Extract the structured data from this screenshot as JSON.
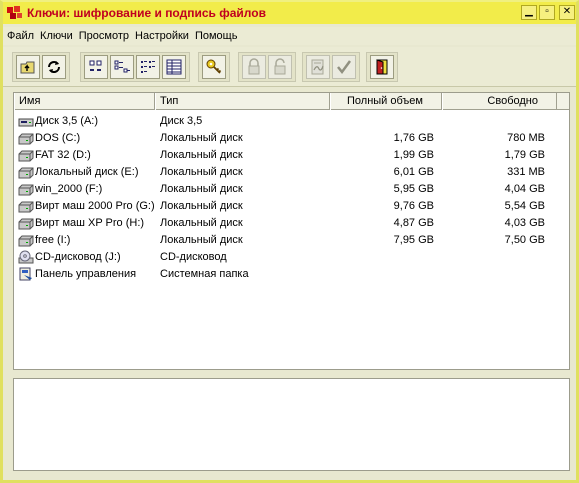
{
  "window": {
    "title": "Ключи: шифрование и подпись файлов",
    "accent_color": "#f2ec4a",
    "title_color": "#c00020",
    "controls": [
      "minimize-icon",
      "maximize-icon",
      "close-icon"
    ]
  },
  "menu": [
    "Файл",
    "Ключи",
    "Просмотр",
    "Настройки",
    "Помощь"
  ],
  "toolbar": {
    "groups": [
      [
        {
          "icon": "folder-up-icon",
          "enabled": true
        },
        {
          "icon": "refresh-icon",
          "enabled": true
        }
      ],
      [
        {
          "icon": "large-icons-view-icon",
          "enabled": true
        },
        {
          "icon": "small-icons-view-icon",
          "enabled": true
        },
        {
          "icon": "list-view-icon",
          "enabled": true
        },
        {
          "icon": "details-view-icon",
          "enabled": true
        }
      ],
      [
        {
          "icon": "key-icon",
          "enabled": true
        }
      ],
      [
        {
          "icon": "lock-icon",
          "enabled": false
        },
        {
          "icon": "unlock-icon",
          "enabled": false
        }
      ],
      [
        {
          "icon": "sign-icon",
          "enabled": false
        },
        {
          "icon": "verify-check-icon",
          "enabled": false
        }
      ],
      [
        {
          "icon": "exit-door-icon",
          "enabled": true
        }
      ]
    ]
  },
  "table": {
    "columns": [
      "Имя",
      "Тип",
      "Полный объем",
      "Свободно"
    ],
    "rows": [
      {
        "icon": "floppy-drive-icon",
        "name": "Диск 3,5 (A:)",
        "type": "Диск 3,5",
        "total": "",
        "free": ""
      },
      {
        "icon": "hard-drive-icon",
        "name": "DOS (C:)",
        "type": "Локальный диск",
        "total": "1,76 GB",
        "free": "780 MB"
      },
      {
        "icon": "hard-drive-icon",
        "name": "FAT 32 (D:)",
        "type": "Локальный диск",
        "total": "1,99 GB",
        "free": "1,79 GB"
      },
      {
        "icon": "hard-drive-icon",
        "name": "Локальный диск (E:)",
        "type": "Локальный диск",
        "total": "6,01 GB",
        "free": "331 MB"
      },
      {
        "icon": "hard-drive-icon",
        "name": "win_2000 (F:)",
        "type": "Локальный диск",
        "total": "5,95 GB",
        "free": "4,04 GB"
      },
      {
        "icon": "hard-drive-icon",
        "name": "Вирт маш 2000 Pro (G:)",
        "type": "Локальный диск",
        "total": "9,76 GB",
        "free": "5,54 GB"
      },
      {
        "icon": "hard-drive-icon",
        "name": "Вирт маш XP Pro (H:)",
        "type": "Локальный диск",
        "total": "4,87 GB",
        "free": "4,03 GB"
      },
      {
        "icon": "hard-drive-icon",
        "name": "free (I:)",
        "type": "Локальный диск",
        "total": "7,95 GB",
        "free": "7,50 GB"
      },
      {
        "icon": "cd-drive-icon",
        "name": "CD-дисковод (J:)",
        "type": "CD-дисковод",
        "total": "",
        "free": ""
      },
      {
        "icon": "control-panel-icon",
        "name": "Панель управления",
        "type": "Системная папка",
        "total": "",
        "free": ""
      }
    ]
  }
}
